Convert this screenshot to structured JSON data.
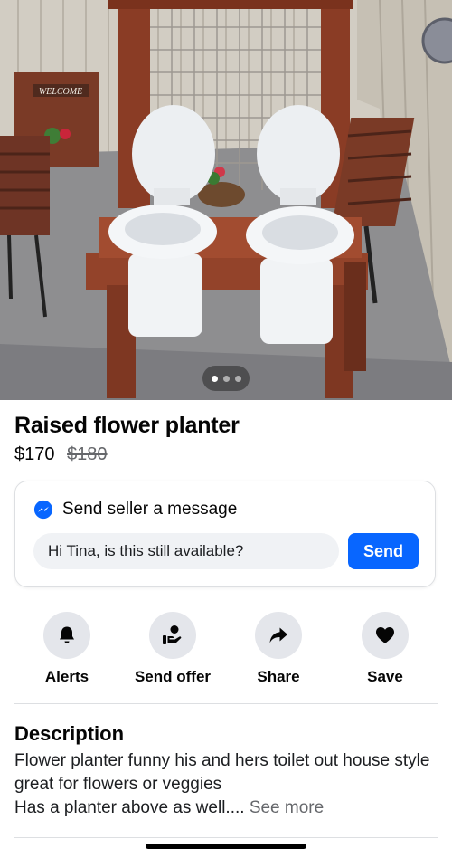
{
  "listing": {
    "title": "Raised flower planter",
    "price": "$170",
    "original_price": "$180",
    "photo": {
      "sign_text": "WELCOME",
      "page_count": 3,
      "active_page": 1
    }
  },
  "message": {
    "heading": "Send seller a message",
    "input_value": "Hi Tina, is this still available?",
    "send_label": "Send",
    "icon": "messenger-icon"
  },
  "actions": [
    {
      "label": "Alerts",
      "icon": "bell-icon"
    },
    {
      "label": "Send offer",
      "icon": "offer-icon"
    },
    {
      "label": "Share",
      "icon": "share-arrow-icon"
    },
    {
      "label": "Save",
      "icon": "heart-icon"
    }
  ],
  "description": {
    "heading": "Description",
    "line1": "Flower planter funny his and hers toilet out house style great for flowers or veggies",
    "line2": "Has a planter above as well....",
    "see_more": "See more"
  },
  "colors": {
    "accent": "#0866ff",
    "icon_circle": "#e4e6eb",
    "muted_text": "#65676b"
  }
}
